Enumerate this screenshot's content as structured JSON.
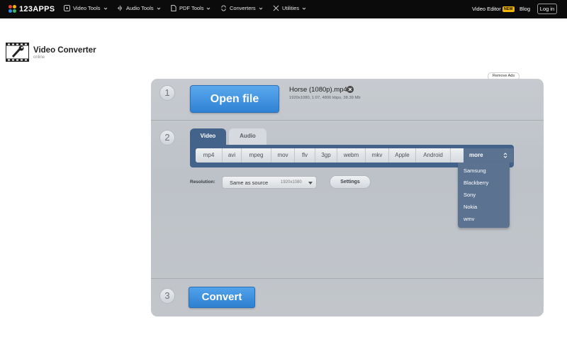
{
  "brand": {
    "logo_text": "123APPS",
    "colors": {
      "dot1": "#e8443a",
      "dot2": "#f5b400",
      "dot3": "#2f8fe8",
      "dot4": "#3cba5c"
    }
  },
  "nav": {
    "items": [
      {
        "label": "Video Tools",
        "icon": "play-icon"
      },
      {
        "label": "Audio Tools",
        "icon": "audio-wave-icon"
      },
      {
        "label": "PDF Tools",
        "icon": "pdf-file-icon"
      },
      {
        "label": "Converters",
        "icon": "convert-arrows-icon"
      },
      {
        "label": "Utilities",
        "icon": "tools-icon"
      }
    ],
    "video_editor": "Video Editor",
    "new_badge": "NEW",
    "blog": "Blog",
    "login": "Log in"
  },
  "app": {
    "title": "Video Converter",
    "subtitle": "online",
    "icon": "film-wrench-icon"
  },
  "remove_ads": "Remove Ads",
  "steps": {
    "one": "1",
    "two": "2",
    "three": "3"
  },
  "file": {
    "open_label": "Open file",
    "name": "Horse (1080p).mp4",
    "meta": "1920x1080, 1:07, 4806 kbps, 38.39 Mb"
  },
  "tabs": {
    "video": "Video",
    "audio": "Audio"
  },
  "formats": [
    "mp4",
    "avi",
    "mpeg",
    "mov",
    "flv",
    "3gp",
    "webm",
    "mkv",
    "Apple",
    "Android"
  ],
  "more_label": "more",
  "more_options": [
    "Samsung",
    "Blackberry",
    "Sony",
    "Nokia",
    "wmv"
  ],
  "resolution": {
    "label": "Resolution:",
    "value": "Same as source",
    "dims": "1920x1080"
  },
  "settings_label": "Settings",
  "convert_label": "Convert"
}
